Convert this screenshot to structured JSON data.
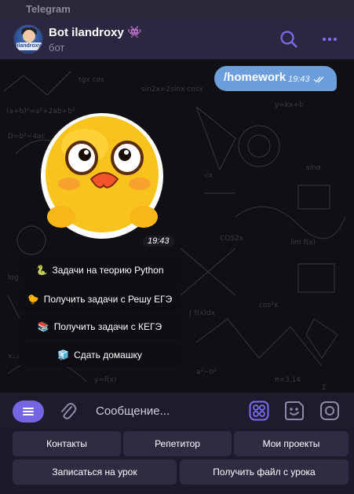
{
  "app": {
    "title": "Telegram"
  },
  "header": {
    "chat_name": "Bot ilandroxy 👾",
    "status": "бот",
    "avatar_text": "ilandroxy"
  },
  "messages": {
    "outgoing": {
      "text": "/homework",
      "time": "19:43"
    },
    "sticker": {
      "time": "19:43"
    }
  },
  "inline_buttons": [
    {
      "emoji": "🐍",
      "label": "Задачи на теорию Python"
    },
    {
      "emoji": "🐤",
      "label": "Получить задачи с Решу ЕГЭ"
    },
    {
      "emoji": "📚",
      "label": "Получить задачи с КЕГЭ"
    },
    {
      "emoji": "🧊",
      "label": "Сдать домашку"
    }
  ],
  "composer": {
    "placeholder": "Сообщение..."
  },
  "reply_keyboard": [
    [
      "Контакты",
      "Репетитор",
      "Мои проекты"
    ],
    [
      "Записаться на урок",
      "Получить файл с урока"
    ]
  ],
  "colors": {
    "accent": "#7365e3",
    "outgoing_bubble": "#6b9edb",
    "header": "#2b2740",
    "keyboard_button": "#2e2b43"
  }
}
